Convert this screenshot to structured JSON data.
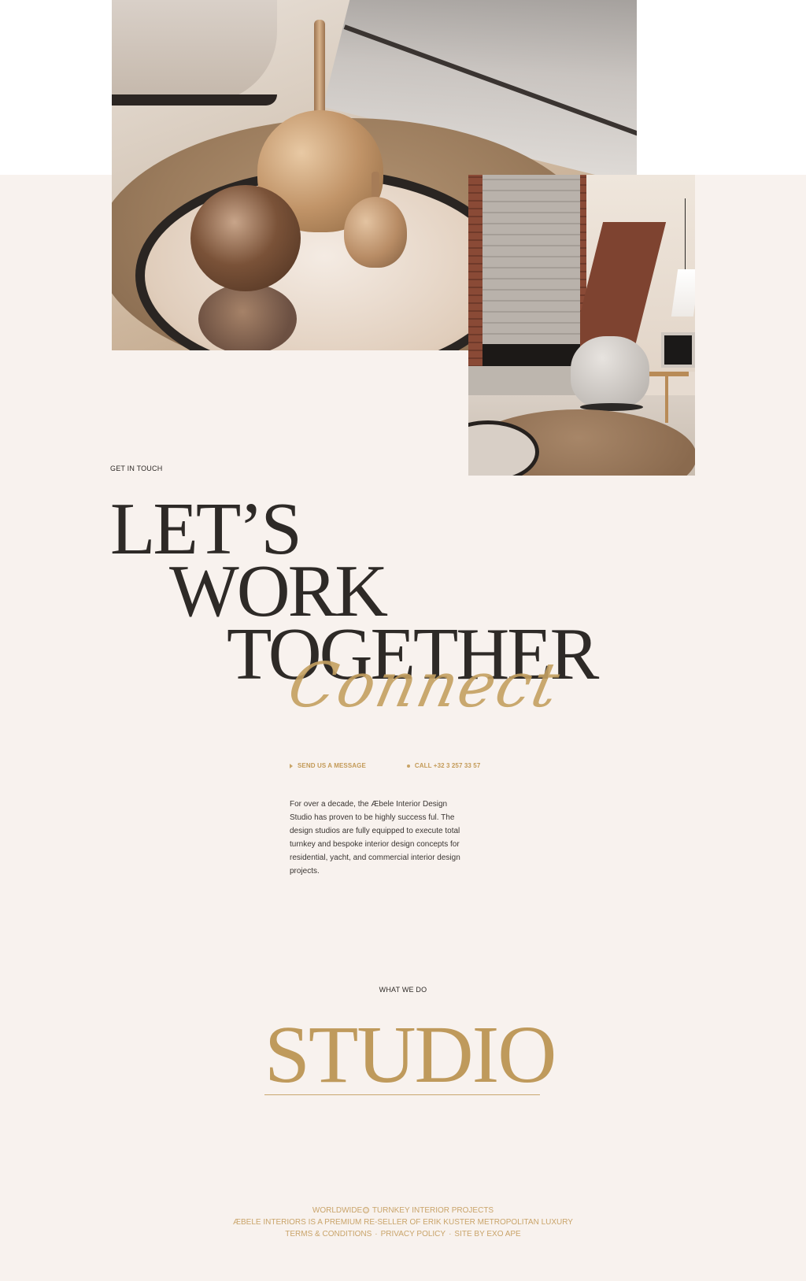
{
  "hero": {
    "eyebrow": "GET IN TOUCH",
    "headline": [
      "LET’S",
      "WORK",
      "TOGETHER"
    ],
    "script_word": "Connect"
  },
  "contact": {
    "message_label": "SEND US A MESSAGE",
    "call_label": "CALL +32 3 257 33 57"
  },
  "intro": {
    "text": "For over a decade, the Æbele Interior Design Studio has proven to be highly success ful. The design studios are fully equipped to execute total turnkey and bespoke interior design concepts for residential, yacht, and commercial interior design projects."
  },
  "services": {
    "eyebrow": "WHAT WE DO",
    "title": "STUDIO"
  },
  "footer": {
    "line1_left": "WORLDWIDE",
    "line1_right": "TURNKEY INTERIOR PROJECTS",
    "line2": "ÆBELE INTERIORS IS A PREMIUM RE-SELLER OF ERIK KUSTER METROPOLITAN LUXURY",
    "links": {
      "terms": "TERMS & CONDITIONS",
      "privacy": "PRIVACY POLICY",
      "credit": "SITE BY EXO APE",
      "separator": "·"
    }
  },
  "images": {
    "photo_1": "vases-on-mirror-tray",
    "photo_2": "fireplace-living-room"
  },
  "colors": {
    "background": "#f8f2ee",
    "ink": "#2e2a27",
    "gold": "#c39a57"
  }
}
